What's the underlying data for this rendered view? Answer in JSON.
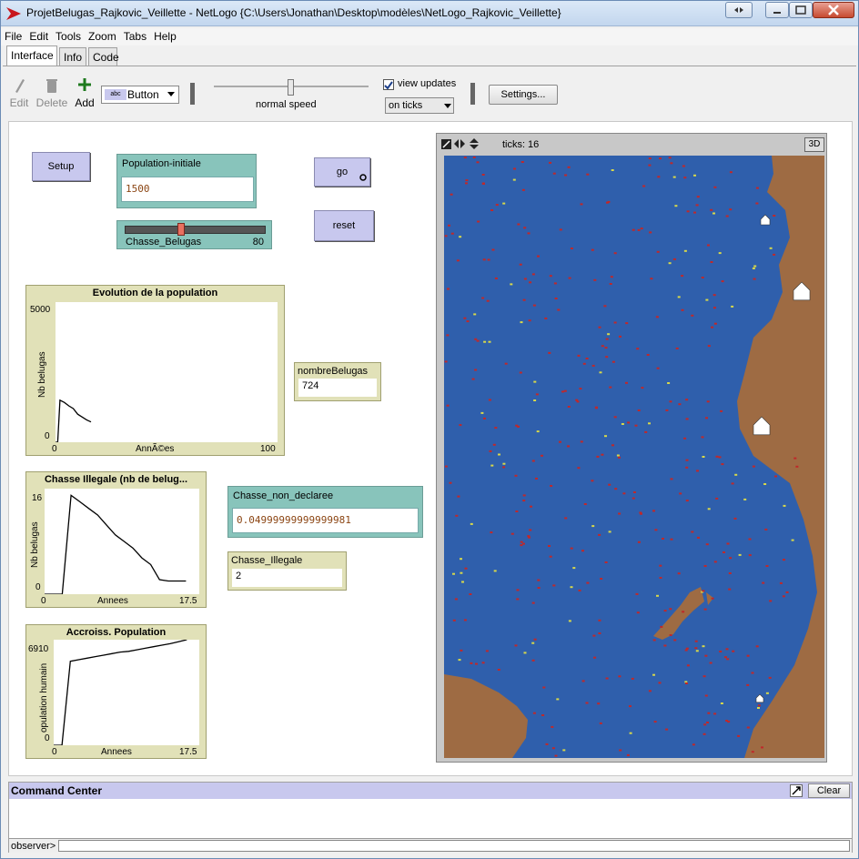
{
  "window": {
    "title": "ProjetBelugas_Rajkovic_Veillette - NetLogo {C:\\Users\\Jonathan\\Desktop\\modèles\\NetLogo_Rajkovic_Veillette}"
  },
  "menu": [
    "File",
    "Edit",
    "Tools",
    "Zoom",
    "Tabs",
    "Help"
  ],
  "tabs": [
    "Interface",
    "Info",
    "Code"
  ],
  "toolbar": {
    "edit": "Edit",
    "delete": "Delete",
    "add": "Add",
    "widget_type": "Button",
    "speed_label": "normal speed",
    "view_updates": "view updates",
    "update_mode": "on ticks",
    "settings": "Settings..."
  },
  "widgets": {
    "setup": "Setup",
    "go": "go",
    "reset": "reset",
    "pop_init": {
      "label": "Population-initiale",
      "value": "1500"
    },
    "slider": {
      "label": "Chasse_Belugas",
      "value": "80",
      "level": 0.4
    },
    "nombre": {
      "label": "nombreBelugas",
      "value": "724"
    },
    "chasse_nd": {
      "label": "Chasse_non_declaree",
      "value": "0.04999999999999981"
    },
    "chasse_ill": {
      "label": "Chasse_Illegale",
      "value": "2"
    }
  },
  "plots": {
    "p1": {
      "title": "Evolution de la population",
      "ymax": "5000",
      "ymin": "0",
      "xmin": "0",
      "xmax": "100",
      "xlabel": "AnnÃ©es",
      "ylabel": "Nb belugas"
    },
    "p2": {
      "title": "Chasse Illegale (nb de belug...",
      "ymax": "16",
      "ymin": "0",
      "xmin": "0",
      "xmax": "17.5",
      "xlabel": "Annees",
      "ylabel": "Nb belugas"
    },
    "p3": {
      "title": "Accroiss. Population",
      "ymax": "6910",
      "ymin": "0",
      "xmin": "0",
      "xmax": "17.5",
      "xlabel": "Annees",
      "ylabel": "opulation humain"
    }
  },
  "chart_data": [
    {
      "type": "line",
      "title": "Evolution de la population",
      "xlabel": "AnnÃ©es",
      "ylabel": "Nb belugas",
      "xlim": [
        0,
        100
      ],
      "ylim": [
        0,
        5000
      ],
      "x": [
        0,
        1,
        2,
        4,
        6,
        8,
        10,
        12,
        14,
        16
      ],
      "y": [
        0,
        0,
        1500,
        1420,
        1300,
        1200,
        1000,
        900,
        800,
        724
      ]
    },
    {
      "type": "line",
      "title": "Chasse Illegale (nb de belug...",
      "xlabel": "Annees",
      "ylabel": "Nb belugas",
      "xlim": [
        0,
        17.5
      ],
      "ylim": [
        0,
        16
      ],
      "x": [
        0,
        1,
        2,
        3,
        4,
        5,
        6,
        7,
        8,
        9,
        10,
        11,
        12,
        13,
        14,
        15,
        16
      ],
      "y": [
        0,
        0,
        0,
        15,
        14,
        13,
        12,
        10.5,
        9,
        8,
        7,
        5.5,
        4.5,
        2.2,
        2,
        2,
        2
      ]
    },
    {
      "type": "line",
      "title": "Accroiss. Population",
      "xlabel": "Annees",
      "ylabel": "opulation humain",
      "xlim": [
        0,
        17.5
      ],
      "ylim": [
        0,
        6910
      ],
      "x": [
        0,
        1,
        2,
        3,
        4,
        5,
        6,
        7,
        8,
        9,
        10,
        11,
        12,
        13,
        14,
        15,
        16
      ],
      "y": [
        0,
        0,
        5500,
        5600,
        5700,
        5800,
        5900,
        6000,
        6100,
        6150,
        6250,
        6350,
        6450,
        6550,
        6650,
        6780,
        6910
      ]
    }
  ],
  "view": {
    "ticks_label": "ticks:",
    "ticks": "16",
    "three_d": "3D",
    "water": "#2f5fac",
    "land": "#9e6b43"
  },
  "command": {
    "title": "Command Center",
    "clear": "Clear",
    "prompt": "observer>"
  }
}
